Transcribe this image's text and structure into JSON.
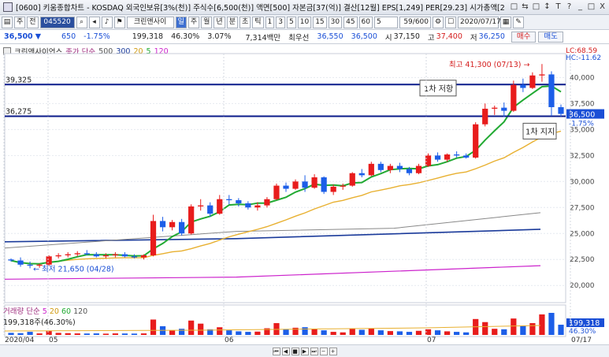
{
  "window": {
    "title": "[0600] 키움종합차트 - KOSDAQ 외국인보유[3%(천)] 주식수[6,500(천)] 액면[500] 자본금[37(억)] 결산[12월] EPS[1,249] PER[29.23] 시가총액[2",
    "controls": [
      "□",
      "⇆",
      "□",
      "↕",
      "T",
      "?",
      "_",
      "□",
      "X"
    ]
  },
  "toolbar": {
    "period_label": "주",
    "prev_label": "전",
    "code": "045520",
    "stock_name": "크린앤사이",
    "selected_type": "일",
    "types": [
      "주",
      "월",
      "년",
      "분",
      "초",
      "틱"
    ],
    "minute_options": [
      "1",
      "3",
      "5",
      "10",
      "15",
      "30",
      "45",
      "60"
    ],
    "interval": "5",
    "count": "59/600",
    "date": "2020/07/17"
  },
  "quote": {
    "price": "36,500",
    "arrow": "▼",
    "change": "650",
    "change_pct": "-1.75%",
    "volume": "199,318",
    "vol_ratio": "46.30%",
    "turnover": "3.07%",
    "amount": "7,314백만",
    "best_label": "최우선",
    "ask": "36,550",
    "bid": "36,500",
    "open_label": "시",
    "open": "37,150",
    "high_label": "고",
    "high": "37,400",
    "low_label": "저",
    "low": "36,250",
    "buy_label": "매수",
    "sell_label": "매도"
  },
  "legend": {
    "name": "크린앤사이언스",
    "price_label": "종가 단순",
    "ma": [
      "500",
      "300",
      "20",
      "5",
      "120"
    ],
    "ma_colors": [
      "#555555",
      "#1a3a9a",
      "#e8b030",
      "#22aa33",
      "#cc22cc"
    ],
    "volume_label": "거래량 단순",
    "vol_ma": [
      "5",
      "20",
      "60",
      "120"
    ],
    "volume_value": "199,318주(46.30%)"
  },
  "annotations": {
    "resistance_price": "39,325",
    "support_price": "36,275",
    "high_text": "최고 41,300 (07/13)",
    "low_text": "최저 21,650 (04/28)",
    "resistance_box": "1차 저항",
    "support_box": "1차 지지",
    "lc": "LC:68.59",
    "hc": "HC:-11.62",
    "last_price": "36,500",
    "last_pct": "-1.75%",
    "vol_last": "199,318",
    "vol_pct": "46.30%"
  },
  "chart_data": {
    "type": "candlestick",
    "y_axis": [
      "40,000",
      "37,500",
      "35,000",
      "32,500",
      "30,000",
      "27,500",
      "25,000",
      "22,500",
      "20,000"
    ],
    "x_axis": [
      "2020/04",
      "05",
      "06",
      "07",
      "07/17"
    ],
    "candles": [
      [
        22500,
        22600,
        22300,
        22400
      ],
      [
        22400,
        22700,
        21800,
        22000
      ],
      [
        22000,
        22300,
        21650,
        21900
      ],
      [
        21900,
        22100,
        21700,
        22000
      ],
      [
        22000,
        22900,
        21900,
        22800
      ],
      [
        22800,
        23100,
        22600,
        22900
      ],
      [
        22900,
        23200,
        22700,
        23000
      ],
      [
        23000,
        23300,
        22800,
        23100
      ],
      [
        23100,
        23400,
        22900,
        23000
      ],
      [
        23000,
        23200,
        22700,
        22800
      ],
      [
        22800,
        23100,
        22600,
        22900
      ],
      [
        22900,
        23200,
        22700,
        23000
      ],
      [
        23000,
        23200,
        22700,
        22800
      ],
      [
        22800,
        23000,
        22600,
        22700
      ],
      [
        22700,
        23000,
        22500,
        22900
      ],
      [
        22900,
        26800,
        22800,
        26200
      ],
      [
        26200,
        26600,
        25200,
        25600
      ],
      [
        25600,
        26300,
        25300,
        26100
      ],
      [
        26100,
        26400,
        24800,
        25000
      ],
      [
        25000,
        27800,
        24900,
        27600
      ],
      [
        27600,
        28300,
        27200,
        27700
      ],
      [
        27700,
        28000,
        26600,
        26900
      ],
      [
        26900,
        28700,
        26800,
        28300
      ],
      [
        28300,
        28700,
        27800,
        28200
      ],
      [
        28200,
        28400,
        27600,
        27900
      ],
      [
        27900,
        28100,
        27300,
        27500
      ],
      [
        27500,
        28000,
        27200,
        27700
      ],
      [
        27700,
        28500,
        27500,
        28300
      ],
      [
        28300,
        29800,
        28200,
        29600
      ],
      [
        29600,
        29900,
        29000,
        29300
      ],
      [
        29300,
        30200,
        29200,
        30000
      ],
      [
        30000,
        30600,
        29000,
        29400
      ],
      [
        29400,
        30700,
        29300,
        30400
      ],
      [
        30400,
        30500,
        28800,
        29000
      ],
      [
        29000,
        29700,
        28700,
        29500
      ],
      [
        29500,
        29800,
        29200,
        29600
      ],
      [
        29600,
        30900,
        29500,
        30800
      ],
      [
        30800,
        31200,
        30400,
        30600
      ],
      [
        30600,
        31900,
        30500,
        31700
      ],
      [
        31700,
        31900,
        30900,
        31100
      ],
      [
        31100,
        31700,
        30800,
        31500
      ],
      [
        31500,
        31800,
        30900,
        31200
      ],
      [
        31200,
        31400,
        30600,
        30800
      ],
      [
        30800,
        31700,
        30700,
        31500
      ],
      [
        31500,
        32700,
        31400,
        32500
      ],
      [
        32500,
        32800,
        31900,
        32100
      ],
      [
        32100,
        32700,
        31900,
        32600
      ],
      [
        32600,
        32900,
        32300,
        32500
      ],
      [
        32500,
        32700,
        32200,
        32300
      ],
      [
        32300,
        35700,
        32200,
        35500
      ],
      [
        35500,
        37500,
        35300,
        37000
      ],
      [
        37000,
        37300,
        36400,
        37100
      ],
      [
        37100,
        37600,
        36200,
        36800
      ],
      [
        36800,
        39700,
        36700,
        39300
      ],
      [
        39300,
        39900,
        38600,
        39000
      ],
      [
        39000,
        40500,
        38900,
        40200
      ],
      [
        40200,
        41300,
        39600,
        40300
      ],
      [
        40300,
        40600,
        36300,
        37150
      ],
      [
        37150,
        37400,
        36250,
        36500
      ]
    ],
    "volume": [
      40,
      35,
      60,
      30,
      80,
      40,
      35,
      30,
      28,
      30,
      25,
      30,
      28,
      26,
      30,
      300,
      170,
      90,
      120,
      280,
      220,
      110,
      150,
      90,
      70,
      60,
      65,
      130,
      230,
      110,
      140,
      150,
      120,
      90,
      60,
      50,
      120,
      100,
      130,
      90,
      75,
      70,
      60,
      80,
      110,
      90,
      70,
      60,
      50,
      310,
      250,
      120,
      110,
      320,
      180,
      230,
      400,
      430,
      199
    ]
  }
}
